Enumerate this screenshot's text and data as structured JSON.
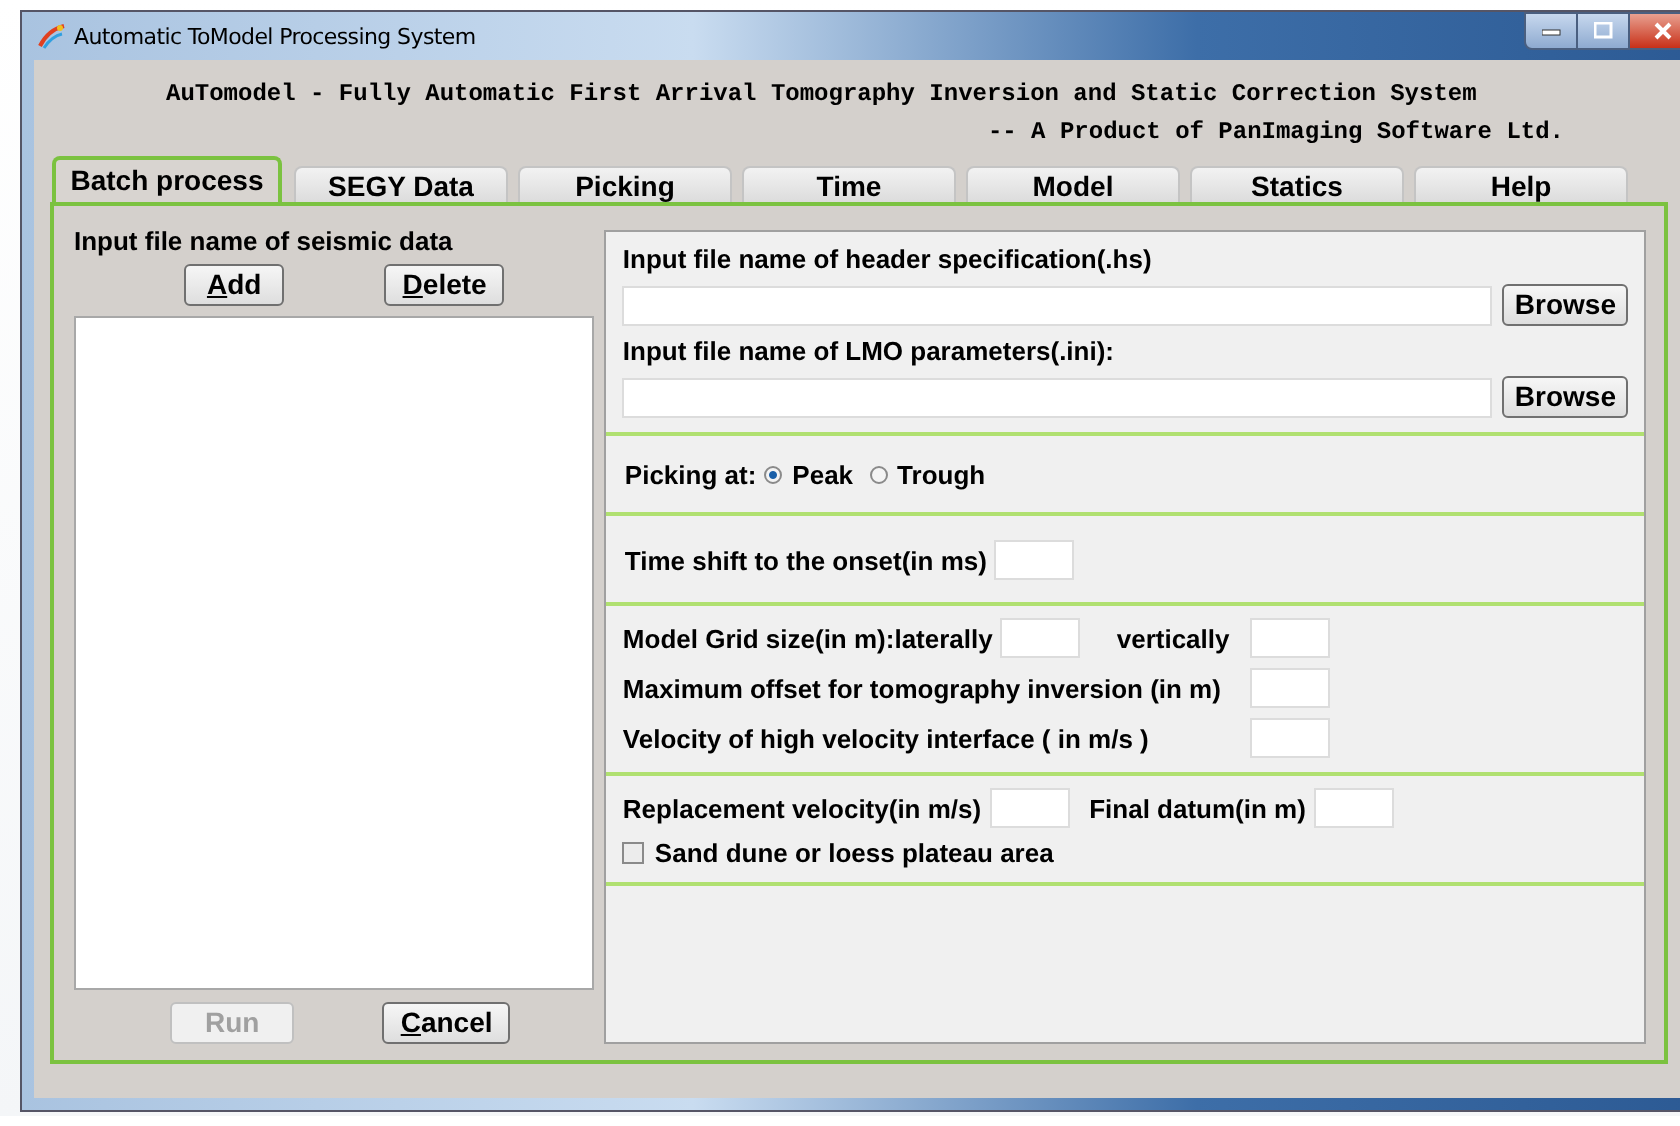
{
  "window": {
    "title": "Automatic ToModel Processing System"
  },
  "header": {
    "line_1": "AuTomodel - Fully Automatic First Arrival Tomography Inversion and Static Correction System",
    "line_2": "-- A Product of PanImaging Software Ltd."
  },
  "tabs": [
    {
      "label": "Batch process",
      "selected": true
    },
    {
      "label": "SEGY Data",
      "selected": false
    },
    {
      "label": "Picking",
      "selected": false
    },
    {
      "label": "Time",
      "selected": false
    },
    {
      "label": "Model",
      "selected": false
    },
    {
      "label": "Statics",
      "selected": false
    },
    {
      "label": "Help",
      "selected": false
    }
  ],
  "input_list": {
    "label": "Input file name of seismic data",
    "buttons": [
      {
        "label": "Add",
        "underline_first": true,
        "disabled": false
      },
      {
        "label": "Delete",
        "underline_first": true,
        "disabled": false
      }
    ],
    "actions": [
      {
        "label": "Run",
        "underline_first": false,
        "disabled": true
      },
      {
        "label": "Cancel",
        "underline_first": true,
        "disabled": false
      }
    ]
  },
  "sections": [
    {
      "kind": "plain",
      "rows": [
        {
          "items": [
            {
              "kind": "label",
              "text": "Input file name of header specification(.hs)"
            }
          ]
        },
        {
          "items": [
            {
              "kind": "file"
            },
            {
              "kind": "button",
              "text": "Browse"
            }
          ]
        },
        {
          "items": [
            {
              "kind": "label",
              "text": "Input file name of LMO parameters(.ini):"
            }
          ]
        },
        {
          "items": [
            {
              "kind": "file"
            },
            {
              "kind": "button",
              "text": "Browse"
            }
          ]
        }
      ]
    },
    {
      "kind": "plain",
      "rows": [
        {
          "items": [
            {
              "kind": "label",
              "text": "Picking at:"
            },
            {
              "kind": "radio",
              "text": "Peak",
              "selected": true
            },
            {
              "kind": "radio",
              "text": "Trough",
              "selected": false
            }
          ]
        }
      ]
    },
    {
      "kind": "plain",
      "rows": [
        {
          "items": [
            {
              "kind": "label",
              "text": "Time shift to the onset(in ms)"
            },
            {
              "kind": "input"
            }
          ]
        }
      ]
    },
    {
      "kind": "aligned",
      "rows": [
        {
          "items": [
            {
              "kind": "label",
              "text": "Model Grid size(in m):laterally"
            },
            {
              "kind": "input"
            },
            {
              "kind": "label",
              "text": "vertically"
            },
            {
              "kind": "input"
            }
          ]
        },
        {
          "items": [
            {
              "kind": "label",
              "text": "Maximum offset for tomography inversion (in m)"
            },
            {
              "kind": "input"
            }
          ]
        },
        {
          "items": [
            {
              "kind": "label",
              "text": "Velocity of high velocity interface ( in m/s )"
            },
            {
              "kind": "input"
            }
          ]
        }
      ]
    },
    {
      "kind": "plain",
      "rows": [
        {
          "items": [
            {
              "kind": "label",
              "text": "Replacement velocity(in m/s)"
            },
            {
              "kind": "input"
            },
            {
              "kind": "label",
              "text": "Final datum(in m)"
            },
            {
              "kind": "input"
            }
          ]
        },
        {
          "items": [
            {
              "kind": "checkbox",
              "text": "Sand dune or loess plateau area",
              "checked": false
            }
          ]
        }
      ]
    }
  ]
}
